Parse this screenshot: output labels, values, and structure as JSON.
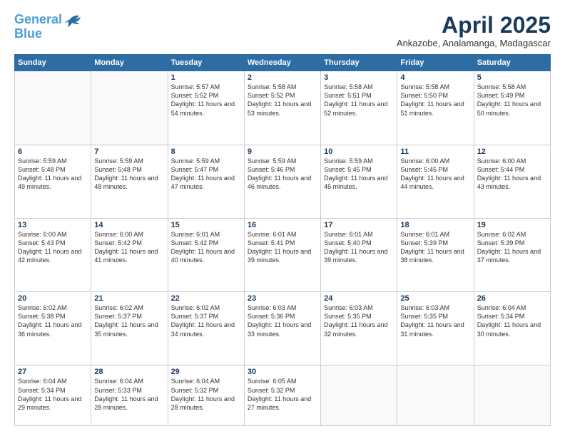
{
  "header": {
    "logo_line1": "General",
    "logo_line2": "Blue",
    "month": "April 2025",
    "location": "Ankazobe, Analamanga, Madagascar"
  },
  "days_of_week": [
    "Sunday",
    "Monday",
    "Tuesday",
    "Wednesday",
    "Thursday",
    "Friday",
    "Saturday"
  ],
  "weeks": [
    [
      {
        "num": "",
        "info": ""
      },
      {
        "num": "",
        "info": ""
      },
      {
        "num": "1",
        "info": "Sunrise: 5:57 AM\nSunset: 5:52 PM\nDaylight: 11 hours and 54 minutes."
      },
      {
        "num": "2",
        "info": "Sunrise: 5:58 AM\nSunset: 5:52 PM\nDaylight: 11 hours and 53 minutes."
      },
      {
        "num": "3",
        "info": "Sunrise: 5:58 AM\nSunset: 5:51 PM\nDaylight: 11 hours and 52 minutes."
      },
      {
        "num": "4",
        "info": "Sunrise: 5:58 AM\nSunset: 5:50 PM\nDaylight: 11 hours and 51 minutes."
      },
      {
        "num": "5",
        "info": "Sunrise: 5:58 AM\nSunset: 5:49 PM\nDaylight: 11 hours and 50 minutes."
      }
    ],
    [
      {
        "num": "6",
        "info": "Sunrise: 5:59 AM\nSunset: 5:48 PM\nDaylight: 11 hours and 49 minutes."
      },
      {
        "num": "7",
        "info": "Sunrise: 5:59 AM\nSunset: 5:48 PM\nDaylight: 11 hours and 48 minutes."
      },
      {
        "num": "8",
        "info": "Sunrise: 5:59 AM\nSunset: 5:47 PM\nDaylight: 11 hours and 47 minutes."
      },
      {
        "num": "9",
        "info": "Sunrise: 5:59 AM\nSunset: 5:46 PM\nDaylight: 11 hours and 46 minutes."
      },
      {
        "num": "10",
        "info": "Sunrise: 5:59 AM\nSunset: 5:45 PM\nDaylight: 11 hours and 45 minutes."
      },
      {
        "num": "11",
        "info": "Sunrise: 6:00 AM\nSunset: 5:45 PM\nDaylight: 11 hours and 44 minutes."
      },
      {
        "num": "12",
        "info": "Sunrise: 6:00 AM\nSunset: 5:44 PM\nDaylight: 11 hours and 43 minutes."
      }
    ],
    [
      {
        "num": "13",
        "info": "Sunrise: 6:00 AM\nSunset: 5:43 PM\nDaylight: 11 hours and 42 minutes."
      },
      {
        "num": "14",
        "info": "Sunrise: 6:00 AM\nSunset: 5:42 PM\nDaylight: 11 hours and 41 minutes."
      },
      {
        "num": "15",
        "info": "Sunrise: 6:01 AM\nSunset: 5:42 PM\nDaylight: 11 hours and 40 minutes."
      },
      {
        "num": "16",
        "info": "Sunrise: 6:01 AM\nSunset: 5:41 PM\nDaylight: 11 hours and 39 minutes."
      },
      {
        "num": "17",
        "info": "Sunrise: 6:01 AM\nSunset: 5:40 PM\nDaylight: 11 hours and 39 minutes."
      },
      {
        "num": "18",
        "info": "Sunrise: 6:01 AM\nSunset: 5:39 PM\nDaylight: 11 hours and 38 minutes."
      },
      {
        "num": "19",
        "info": "Sunrise: 6:02 AM\nSunset: 5:39 PM\nDaylight: 11 hours and 37 minutes."
      }
    ],
    [
      {
        "num": "20",
        "info": "Sunrise: 6:02 AM\nSunset: 5:38 PM\nDaylight: 11 hours and 36 minutes."
      },
      {
        "num": "21",
        "info": "Sunrise: 6:02 AM\nSunset: 5:37 PM\nDaylight: 11 hours and 35 minutes."
      },
      {
        "num": "22",
        "info": "Sunrise: 6:02 AM\nSunset: 5:37 PM\nDaylight: 11 hours and 34 minutes."
      },
      {
        "num": "23",
        "info": "Sunrise: 6:03 AM\nSunset: 5:36 PM\nDaylight: 11 hours and 33 minutes."
      },
      {
        "num": "24",
        "info": "Sunrise: 6:03 AM\nSunset: 5:35 PM\nDaylight: 11 hours and 32 minutes."
      },
      {
        "num": "25",
        "info": "Sunrise: 6:03 AM\nSunset: 5:35 PM\nDaylight: 11 hours and 31 minutes."
      },
      {
        "num": "26",
        "info": "Sunrise: 6:04 AM\nSunset: 5:34 PM\nDaylight: 11 hours and 30 minutes."
      }
    ],
    [
      {
        "num": "27",
        "info": "Sunrise: 6:04 AM\nSunset: 5:34 PM\nDaylight: 11 hours and 29 minutes."
      },
      {
        "num": "28",
        "info": "Sunrise: 6:04 AM\nSunset: 5:33 PM\nDaylight: 11 hours and 28 minutes."
      },
      {
        "num": "29",
        "info": "Sunrise: 6:04 AM\nSunset: 5:32 PM\nDaylight: 11 hours and 28 minutes."
      },
      {
        "num": "30",
        "info": "Sunrise: 6:05 AM\nSunset: 5:32 PM\nDaylight: 11 hours and 27 minutes."
      },
      {
        "num": "",
        "info": ""
      },
      {
        "num": "",
        "info": ""
      },
      {
        "num": "",
        "info": ""
      }
    ]
  ]
}
